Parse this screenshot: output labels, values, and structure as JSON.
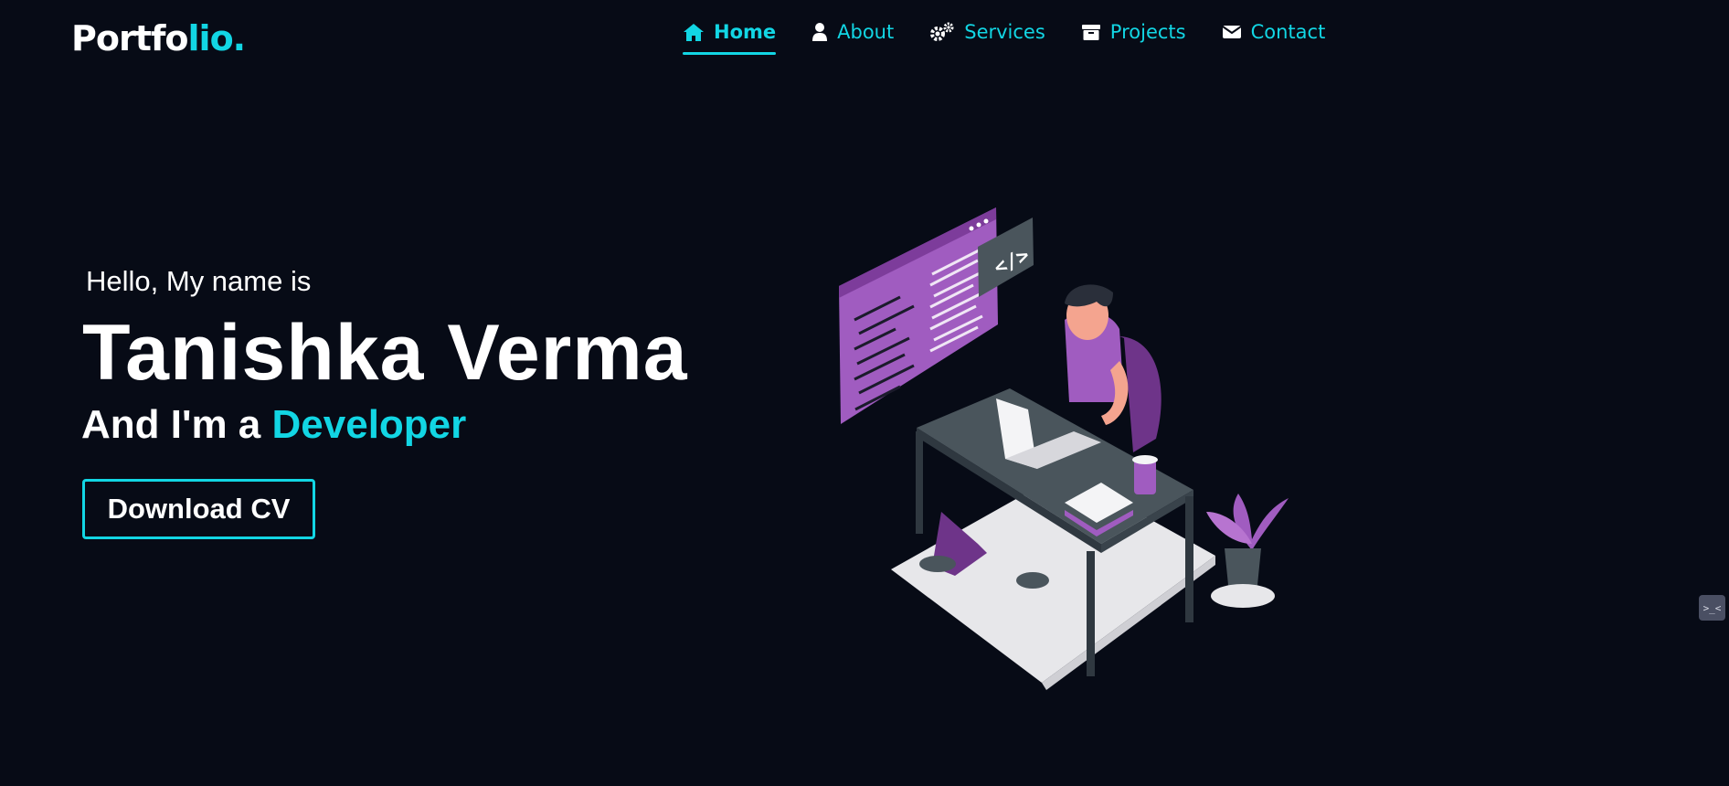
{
  "brand": {
    "logo_main": "Portfo",
    "logo_accent": "lio."
  },
  "nav": {
    "items": [
      {
        "label": "Home",
        "icon": "home-icon",
        "active": true
      },
      {
        "label": "About",
        "icon": "user-icon",
        "active": false
      },
      {
        "label": "Services",
        "icon": "gears-icon",
        "active": false
      },
      {
        "label": "Projects",
        "icon": "archive-icon",
        "active": false
      },
      {
        "label": "Contact",
        "icon": "envelope-icon",
        "active": false
      }
    ]
  },
  "hero": {
    "intro": "Hello, My name is",
    "name": "Tanishka Verma",
    "role_prefix": "And I'm a",
    "role": "Developer",
    "cta_label": "Download CV"
  },
  "illustration": {
    "code_tag": "</>"
  },
  "side_widget": {
    "glyph": ">_<"
  },
  "colors": {
    "background": "#070b16",
    "accent": "#12d6e4",
    "text": "#ffffff",
    "illustration_purple": "#a05cc0"
  }
}
